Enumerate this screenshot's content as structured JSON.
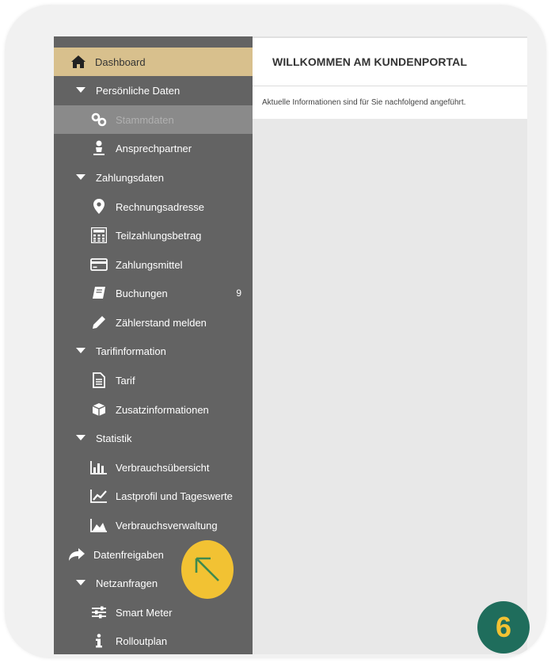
{
  "main": {
    "header_title": "WILLKOMMEN AM KUNDENPORTAL",
    "info_text": "Aktuelle Informationen sind für Sie nachfolgend angeführt."
  },
  "sidebar": {
    "items": [
      {
        "label": "Dashboard",
        "icon": "home-icon",
        "state": "active"
      },
      {
        "label": "Persönliche Daten",
        "icon": "caret-down-icon",
        "type": "section"
      },
      {
        "label": "Stammdaten",
        "icon": "link-icon",
        "state": "disabled"
      },
      {
        "label": "Ansprechpartner",
        "icon": "person-icon"
      },
      {
        "label": "Zahlungsdaten",
        "icon": "caret-down-icon",
        "type": "section"
      },
      {
        "label": "Rechnungsadresse",
        "icon": "map-marker-icon"
      },
      {
        "label": "Teilzahlungsbetrag",
        "icon": "calculator-icon"
      },
      {
        "label": "Zahlungsmittel",
        "icon": "credit-card-icon"
      },
      {
        "label": "Buchungen",
        "icon": "book-icon",
        "badge": "9"
      },
      {
        "label": "Zählerstand melden",
        "icon": "pencil-icon"
      },
      {
        "label": "Tarifinformation",
        "icon": "caret-down-icon",
        "type": "section"
      },
      {
        "label": "Tarif",
        "icon": "document-icon"
      },
      {
        "label": "Zusatzinformationen",
        "icon": "cube-icon"
      },
      {
        "label": "Statistik",
        "icon": "caret-down-icon",
        "type": "section"
      },
      {
        "label": "Verbrauchsübersicht",
        "icon": "bar-chart-icon"
      },
      {
        "label": "Lastprofil und Tageswerte",
        "icon": "line-chart-icon"
      },
      {
        "label": "Verbrauchsverwaltung",
        "icon": "area-chart-icon"
      },
      {
        "label": "Datenfreigaben",
        "icon": "share-arrow-icon",
        "type": "top"
      },
      {
        "label": "Netzanfragen",
        "icon": "caret-down-icon",
        "type": "section"
      },
      {
        "label": "Smart Meter",
        "icon": "sliders-icon"
      },
      {
        "label": "Rolloutplan",
        "icon": "info-icon"
      }
    ]
  },
  "overlay": {
    "step_number": "6",
    "colors": {
      "accent_yellow": "#f2c233",
      "badge_green": "#1f6d5c",
      "sidebar_gray": "#636363",
      "active_gold": "#d8c08d"
    }
  }
}
